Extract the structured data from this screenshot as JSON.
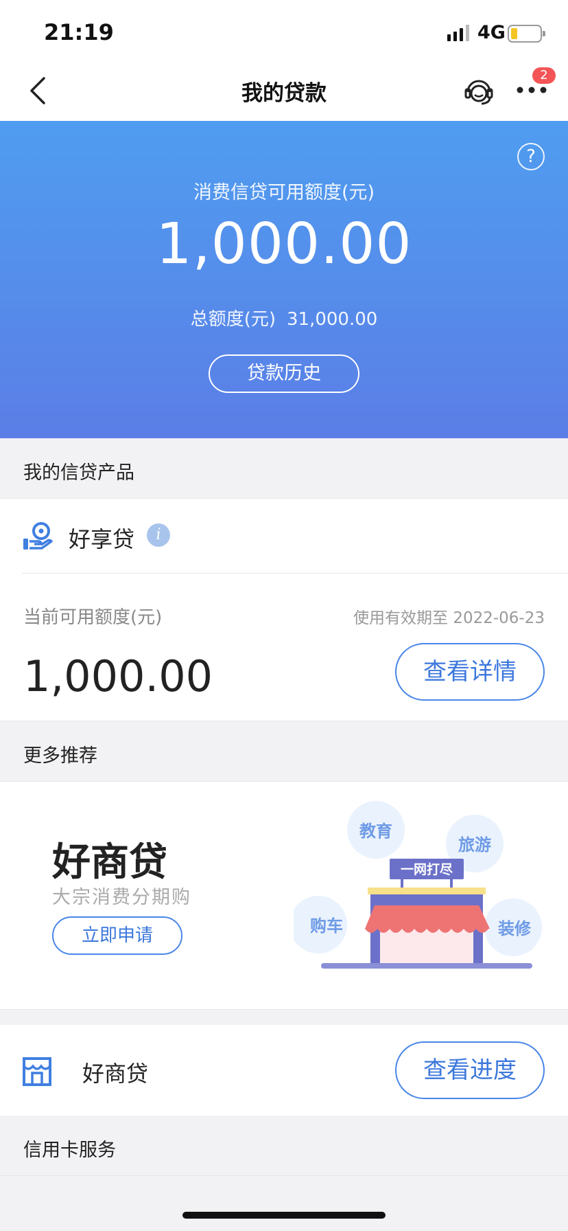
{
  "status_bar": {
    "time": "21:19",
    "network": "4G",
    "battery_level": 0.2,
    "battery_color": "#f5c425"
  },
  "nav": {
    "title": "我的贷款",
    "more_badge": "2"
  },
  "hero": {
    "available_label": "消费信贷可用额度(元)",
    "available_amount": "1,000.00",
    "total_label": "总额度(元)",
    "total_amount": "31,000.00",
    "history_button": "贷款历史",
    "help_icon": "?",
    "gradient_top": "#4f9df0",
    "gradient_bottom": "#5b7ee6"
  },
  "products": {
    "header": "我的信贷产品",
    "item": {
      "name": "好享贷",
      "info_icon": "i",
      "current_label": "当前可用额度(元)",
      "valid_until": "使用有效期至 2022-06-23",
      "amount": "1,000.00",
      "detail_button": "查看详情"
    }
  },
  "recommend": {
    "header": "更多推荐",
    "banner": {
      "title": "好商贷",
      "subtitle": "大宗消费分期购",
      "apply_button": "立即申请",
      "bubbles": [
        "教育",
        "旅游",
        "购车",
        "装修"
      ],
      "sign": "一网打尽"
    },
    "biz": {
      "name": "好商贷",
      "progress_button": "查看进度"
    }
  },
  "credit_card": {
    "header": "信用卡服务"
  },
  "accent_color": "#4a86e8"
}
